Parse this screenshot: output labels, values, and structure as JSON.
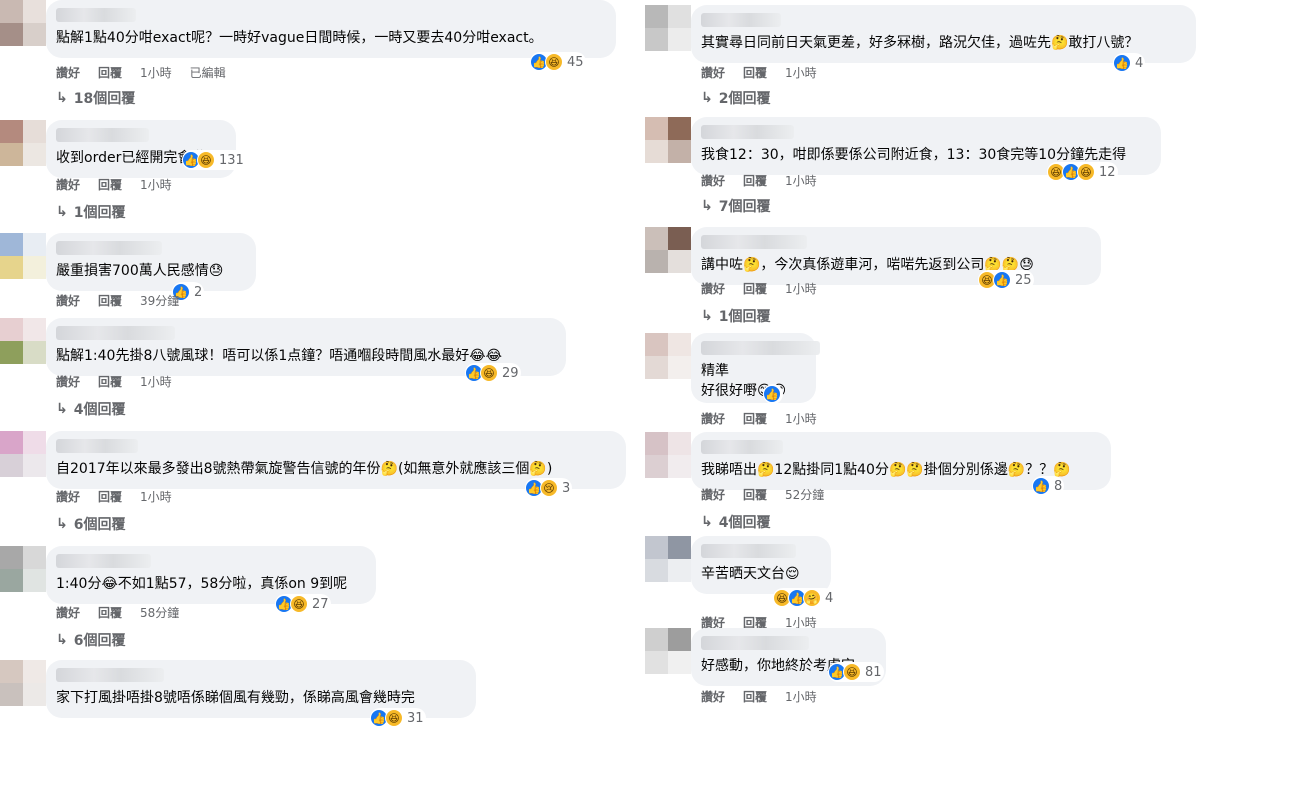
{
  "ui": {
    "like": "讚好",
    "reply": "回覆"
  },
  "left": [
    {
      "text": [
        "點解1點40分咁exact呢？一時好vague日間時候，一時又要去40分咁exact。"
      ],
      "reactions": [
        "like",
        "haha"
      ],
      "count": "45",
      "time": "1小時",
      "edited": "已編輯",
      "replies": "18個回覆"
    },
    {
      "text": [
        "收到order已經開完會啦"
      ],
      "reactions": [
        "like",
        "haha"
      ],
      "count": "131",
      "time": "1小時",
      "replies": "1個回覆"
    },
    {
      "text": [
        "嚴重損害700萬人民感情😓"
      ],
      "reactions": [
        "like"
      ],
      "count": "2",
      "time": "39分鐘",
      "replies": ""
    },
    {
      "text": [
        "點解1:40先掛8八號風球！唔可以係1点鐘？唔通嗰段時間風水最好😂😂"
      ],
      "reactions": [
        "like",
        "haha"
      ],
      "count": "29",
      "time": "1小時",
      "replies": "4個回覆"
    },
    {
      "text": [
        "自2017年以來最多發出8號熱帶氣旋警告信號的年份🤔(如無意外就應該三個🤔)"
      ],
      "reactions": [
        "like",
        "sad"
      ],
      "count": "3",
      "time": "1小時",
      "replies": "6個回覆"
    },
    {
      "text": [
        "1:40分😂不如1點57，58分啦，真係on 9到呢"
      ],
      "reactions": [
        "like",
        "haha"
      ],
      "count": "27",
      "time": "58分鐘",
      "replies": "6個回覆"
    },
    {
      "text": [
        "家下打風掛唔掛8號唔係睇個風有幾勁，係睇高風會幾時完"
      ],
      "reactions": [
        "like",
        "haha"
      ],
      "count": "31",
      "time": "",
      "replies": ""
    }
  ],
  "right": [
    {
      "text": [
        "其實尋日同前日天氣更差，好多冧樹，路況欠佳，過咗先🤔敢打八號？"
      ],
      "reactions": [
        "like"
      ],
      "count": "4",
      "time": "1小時",
      "replies": "2個回覆"
    },
    {
      "text": [
        "我食12：30，咁即係要係公司附近食，13：30食完等10分鐘先走得"
      ],
      "reactions": [
        "haha",
        "like",
        "haha"
      ],
      "count": "12",
      "time": "1小時",
      "replies": "7個回覆"
    },
    {
      "text": [
        "講中咗🤔，今次真係遊車河，啱啱先返到公司🤔🤔😓"
      ],
      "reactions": [
        "haha",
        "like"
      ],
      "count": "25",
      "time": "1小時",
      "replies": "1個回覆"
    },
    {
      "text": [
        "精準",
        "好很好嘢😊😊"
      ],
      "reactions": [
        "like"
      ],
      "count": "",
      "time": "1小時",
      "replies": ""
    },
    {
      "text": [
        "我睇唔出🤔12點掛同1點40分🤔🤔掛個分別係邊🤔？？🤔"
      ],
      "reactions": [
        "like"
      ],
      "count": "8",
      "time": "52分鐘",
      "replies": "4個回覆"
    },
    {
      "text": [
        "辛苦晒天文台😌"
      ],
      "reactions": [
        "haha",
        "like",
        "care"
      ],
      "count": "4",
      "time": "1小時",
      "replies": ""
    },
    {
      "text": [
        "好感動，你地終於考慮完"
      ],
      "reactions": [
        "like",
        "haha"
      ],
      "count": "81",
      "time": "1小時",
      "replies": ""
    }
  ],
  "icons": {
    "like": "👍",
    "haha": "😆",
    "sad": "😢",
    "care": "🤗"
  }
}
